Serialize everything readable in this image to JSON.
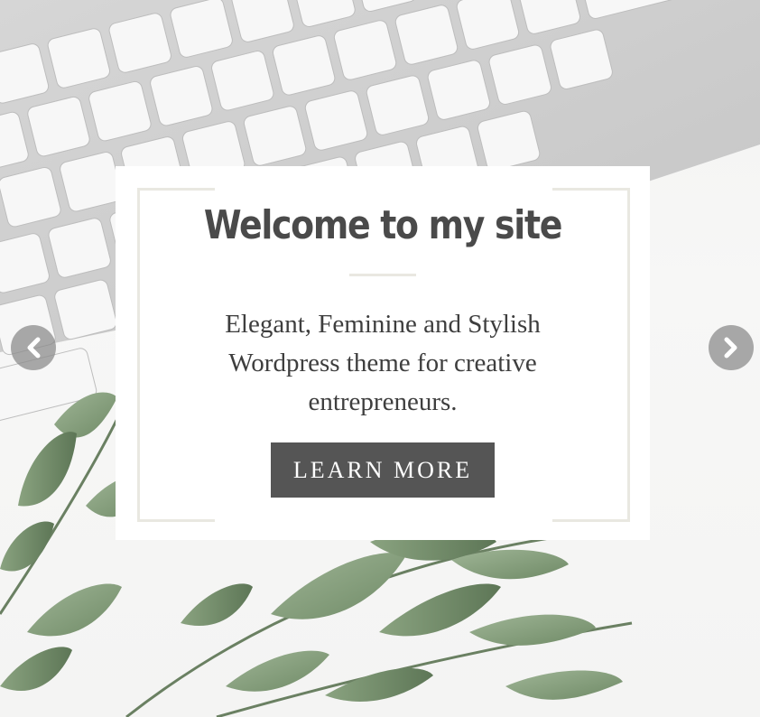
{
  "hero": {
    "background_image": "keyboard-and-eucalyptus-photo",
    "prev_icon": "chevron-left-icon",
    "next_icon": "chevron-right-icon"
  },
  "card": {
    "title": "Welcome to my site",
    "description": "Elegant, Feminine and Stylish Wordpress theme for creative entrepreneurs.",
    "button_label": "LEARN MORE"
  },
  "colors": {
    "button_bg": "#555555",
    "frame_accent": "#e9e8e1",
    "title_text": "#4a4a4a",
    "leaf_green": "#8ea785"
  }
}
